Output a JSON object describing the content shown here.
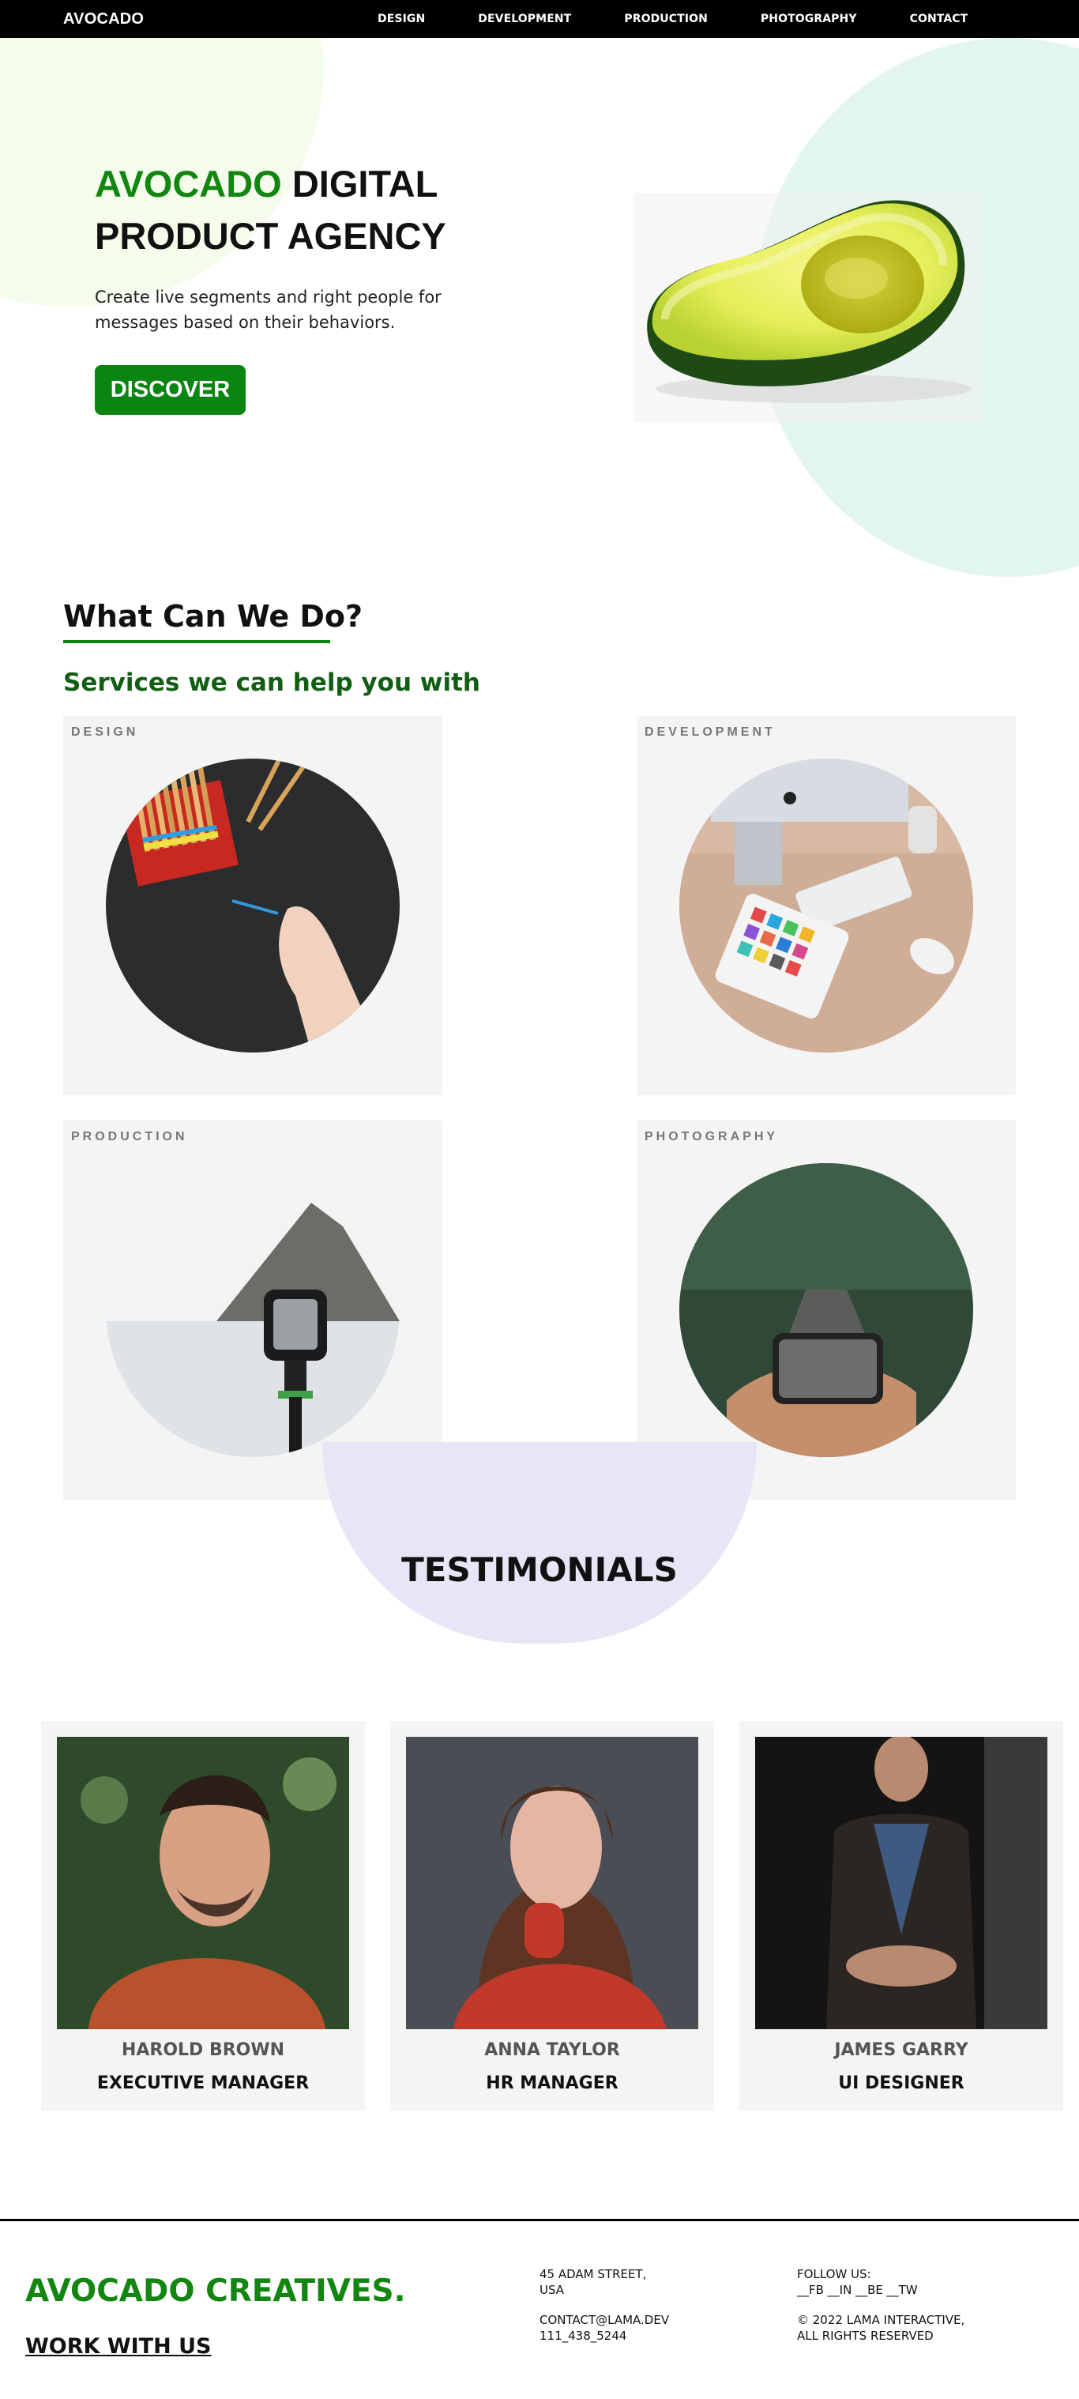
{
  "navbar": {
    "logo": "AVOCADO",
    "links": [
      "DESIGN",
      "DEVELOPMENT",
      "PRODUCTION",
      "PHOTOGRAPHY",
      "CONTACT"
    ]
  },
  "hero": {
    "title_green": "AVOCADO",
    "title_rest_1": "DIGITAL",
    "title_rest_2": "PRODUCT AGENCY",
    "description": "Create live segments and right people for messages based on their behaviors.",
    "button_label": "DISCOVER"
  },
  "services": {
    "title": "What Can We Do?",
    "subtitle": "Services we can help you with",
    "cards": [
      {
        "label": "DESIGN",
        "icon": "design-photo"
      },
      {
        "label": "DEVELOPMENT",
        "icon": "development-photo"
      },
      {
        "label": "PRODUCTION",
        "icon": "production-photo"
      },
      {
        "label": "PHOTOGRAPHY",
        "icon": "photography-photo"
      }
    ]
  },
  "testimonials": {
    "title": "TESTIMONIALS",
    "people": [
      {
        "name": "HAROLD BROWN",
        "role": "EXECUTIVE MANAGER"
      },
      {
        "name": "ANNA TAYLOR",
        "role": "HR MANAGER"
      },
      {
        "name": "JAMES GARRY",
        "role": "UI DESIGNER"
      }
    ]
  },
  "footer": {
    "brand": "AVOCADO CREATIVES.",
    "work_link": "WORK WITH US",
    "address_1": "45 ADAM STREET,",
    "address_2": "USA",
    "email": "CONTACT@LAMA.DEV",
    "phone": "111_438_5244",
    "follow_label": "FOLLOW US:",
    "socials": "__FB __IN __BE __TW",
    "copyright_1": "© 2022 LAMA INTERACTIVE,",
    "copyright_2": "ALL RIGHTS RESERVED"
  },
  "colors": {
    "brand_green": "#138612",
    "button_green": "#0a8512",
    "dark_green_text": "#115d12",
    "card_bg": "#f4f4f4",
    "testimonial_arc": "#e6e6f6"
  }
}
